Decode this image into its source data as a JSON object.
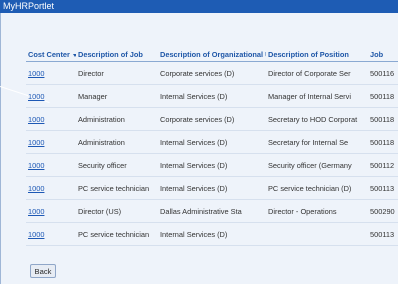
{
  "portlet": {
    "title": "MyHRPortlet"
  },
  "table": {
    "columns": [
      "Cost Center",
      "Description of Job",
      "Description of Organizational Unit",
      "Description of Position",
      "Job"
    ],
    "rows": [
      [
        "1000",
        "Director",
        "Corporate services (D)",
        "Director of Corporate Ser",
        "500116"
      ],
      [
        "1000",
        "Manager",
        "Internal Services (D)",
        "Manager of Internal Servi",
        "500118"
      ],
      [
        "1000",
        "Administration",
        "Corporate services (D)",
        "Secretary to HOD Corporat",
        "500118"
      ],
      [
        "1000",
        "Administration",
        "Internal Services (D)",
        "Secretary for Internal Se",
        "500118"
      ],
      [
        "1000",
        "Security officer",
        "Internal Services (D)",
        "Security officer (Germany",
        "500112"
      ],
      [
        "1000",
        "PC service technician",
        "Internal Services (D)",
        "PC service technician (D)",
        "500113"
      ],
      [
        "1000",
        "Director (US)",
        "Dallas Administrative Sta",
        "Director - Operations",
        "500290"
      ],
      [
        "1000",
        "PC service technician",
        "Internal Services (D)",
        "",
        "500113"
      ]
    ]
  },
  "buttons": {
    "back": "Back"
  },
  "icons": {
    "sort": "sort-desc-icon"
  }
}
